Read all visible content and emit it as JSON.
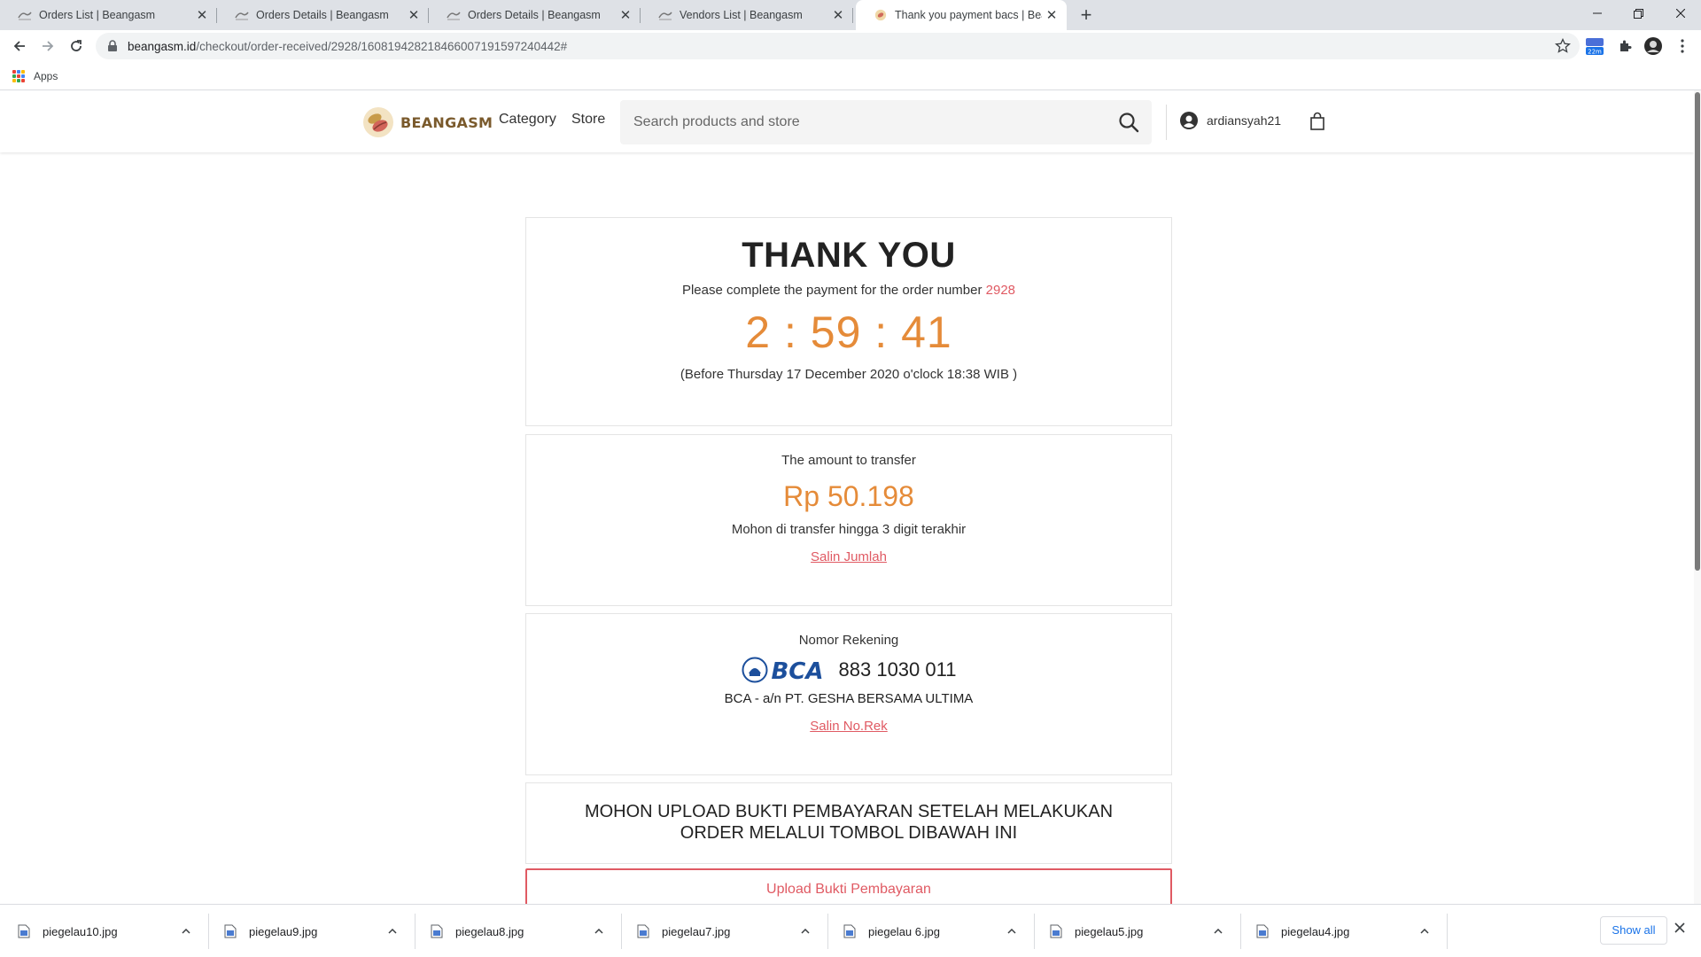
{
  "browser": {
    "tabs": [
      {
        "title": "Orders List | Beangasm",
        "active": false
      },
      {
        "title": "Orders Details | Beangasm",
        "active": false
      },
      {
        "title": "Orders Details | Beangasm",
        "active": false
      },
      {
        "title": "Vendors List | Beangasm",
        "active": false
      },
      {
        "title": "Thank you payment bacs | Beangasm",
        "active": true
      }
    ],
    "url_host": "beangasm.id",
    "url_path": "/checkout/order-received/2928/160819428218466007191597240442#",
    "bookmarks": {
      "apps_label": "Apps"
    },
    "extension_badge": "22m"
  },
  "header": {
    "logo_text": "BEANGASM",
    "nav": {
      "category": "Category",
      "store": "Store"
    },
    "search_placeholder": "Search products and store",
    "username": "ardiansyah21"
  },
  "thank_you": {
    "title": "THANK YOU",
    "pay_prefix": "Please complete the payment for the order number",
    "order_number": "2928",
    "countdown": "2 : 59 : 41",
    "deadline": "(Before Thursday 17 December 2020 o'clock 18:38 WIB )"
  },
  "transfer": {
    "label": "The amount to transfer",
    "amount": "Rp 50.198",
    "note": "Mohon di transfer hingga 3 digit terakhir",
    "copy_link": "Salin Jumlah"
  },
  "account": {
    "label": "Nomor Rekening",
    "bank": "BCA",
    "number": "883 1030 011",
    "owner": "BCA - a/n PT. GESHA BERSAMA ULTIMA",
    "copy_link": "Salin No.Rek"
  },
  "upload": {
    "note": "MOHON UPLOAD BUKTI PEMBAYARAN SETELAH MELAKUKAN ORDER MELALUI TOMBOL DIBAWAH INI",
    "button": "Upload Bukti Pembayaran"
  },
  "downloads": {
    "files": [
      "piegelau10.jpg",
      "piegelau9.jpg",
      "piegelau8.jpg",
      "piegelau7.jpg",
      "piegelau 6.jpg",
      "piegelau5.jpg",
      "piegelau4.jpg"
    ],
    "show_all": "Show all"
  },
  "colors": {
    "accent_red": "#e05a63",
    "accent_orange": "#e58b39",
    "bca_blue": "#1c4f9c"
  }
}
